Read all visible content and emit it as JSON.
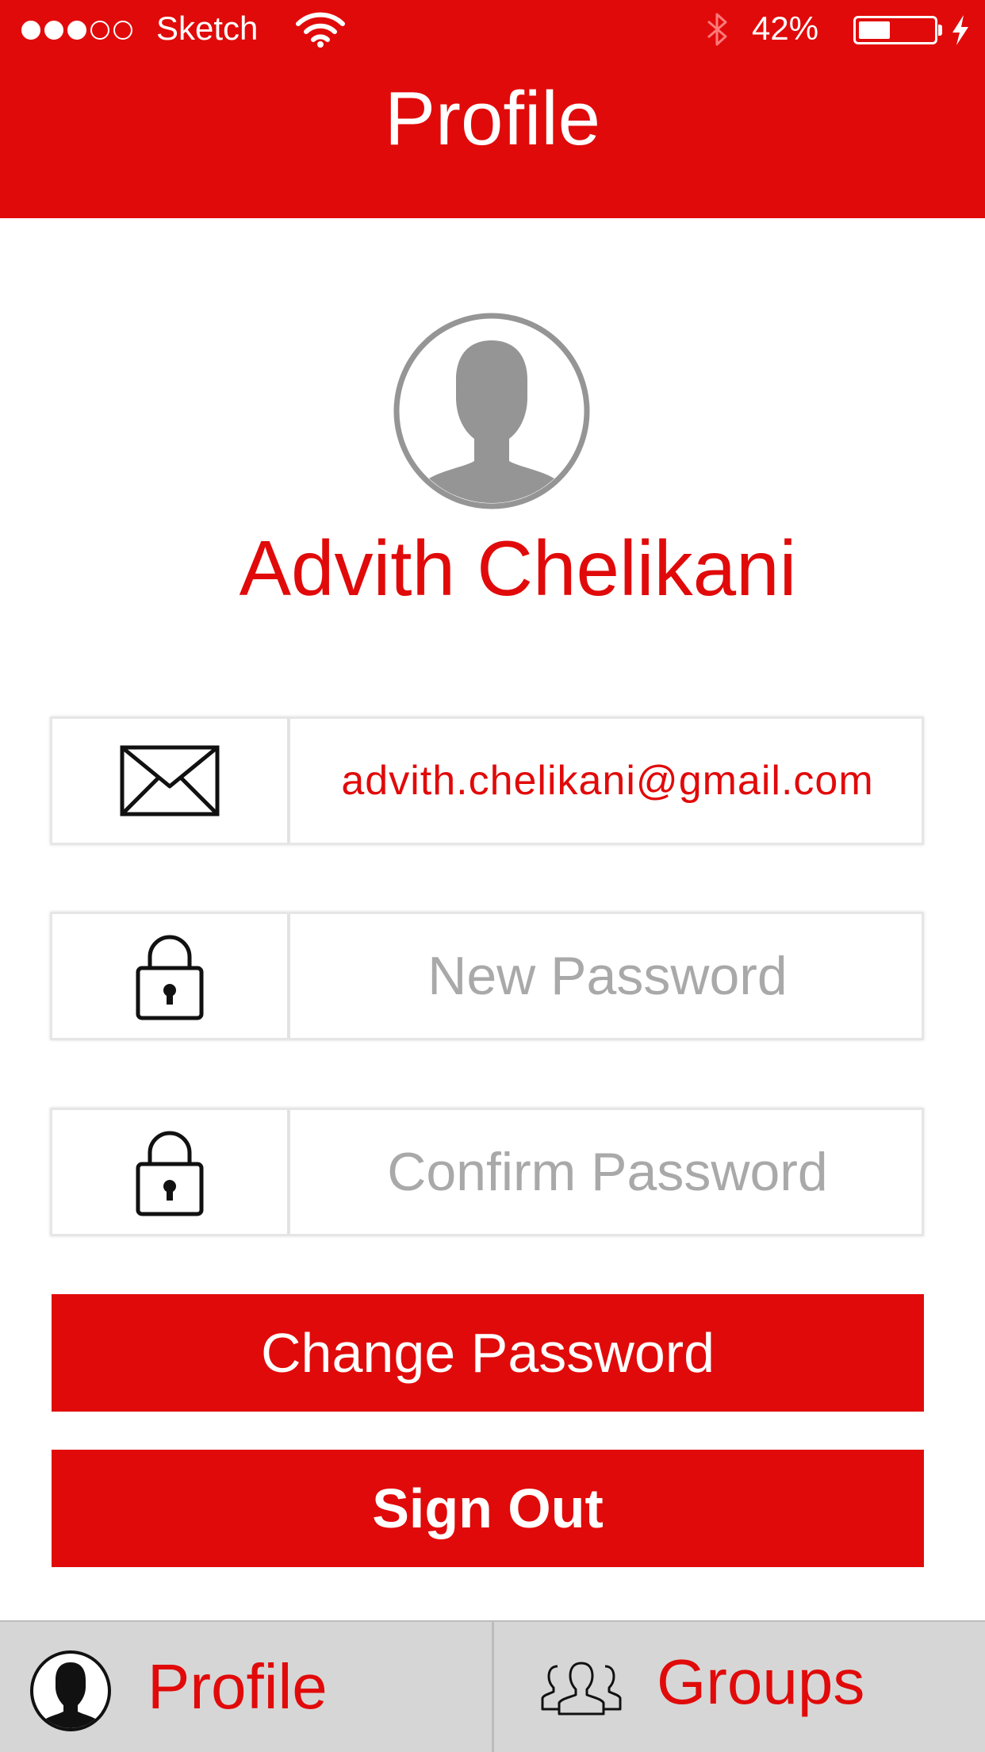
{
  "status_bar": {
    "signal_filled": 3,
    "signal_total": 5,
    "carrier": "Sketch",
    "battery_percent_label": "42%",
    "battery_level": 0.42,
    "icons": [
      "signal-dots-icon",
      "wifi-icon",
      "bluetooth-icon",
      "battery-icon",
      "charging-bolt-icon"
    ]
  },
  "header": {
    "title": "Profile"
  },
  "profile": {
    "name": "Advith Chelikani",
    "avatar_icon": "user-silhouette-icon"
  },
  "fields": {
    "email": {
      "icon": "envelope-icon",
      "value": "advith.chelikani@gmail.com"
    },
    "new_password": {
      "icon": "lock-icon",
      "placeholder": "New Password",
      "value": ""
    },
    "confirm_password": {
      "icon": "lock-icon",
      "placeholder": "Confirm Password",
      "value": ""
    }
  },
  "buttons": {
    "change_password": "Change Password",
    "sign_out": "Sign Out"
  },
  "tabbar": {
    "tabs": [
      {
        "label": "Profile",
        "icon": "person-circle-icon"
      },
      {
        "label": "Groups",
        "icon": "group-icon"
      }
    ]
  },
  "colors": {
    "accent": "#e10a0a",
    "placeholder": "#a9a9a9",
    "avatar_gray": "#959595",
    "tabbar_bg": "#d6d6d6"
  }
}
